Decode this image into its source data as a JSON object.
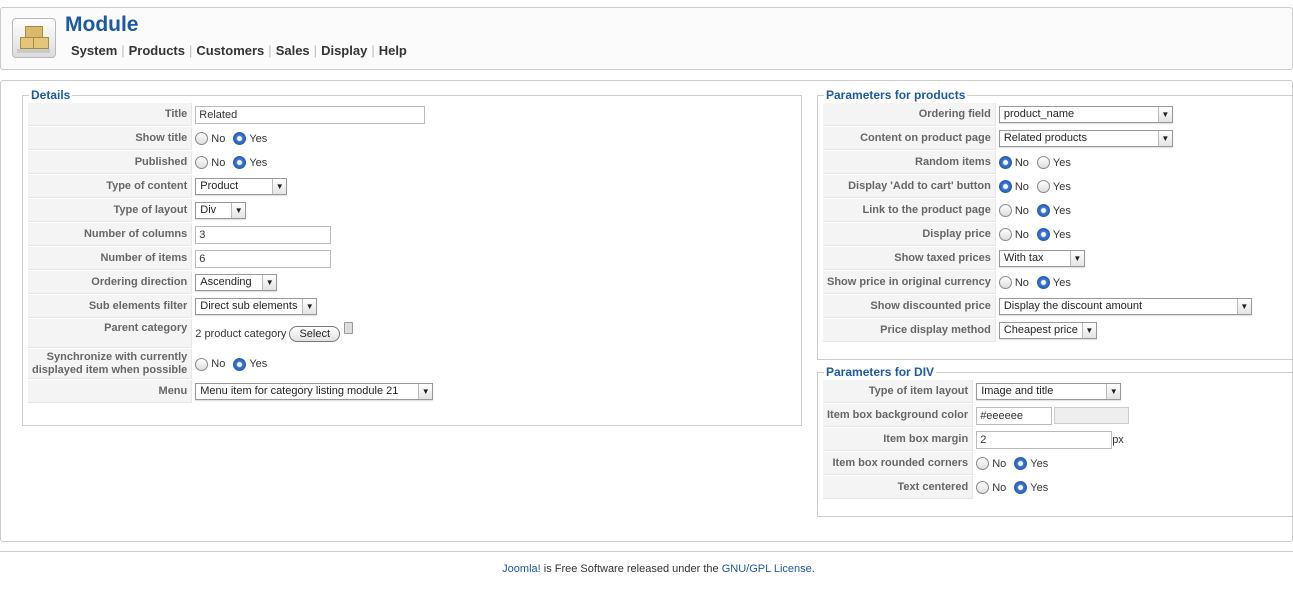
{
  "header": {
    "title": "Module",
    "menu": [
      "System",
      "Products",
      "Customers",
      "Sales",
      "Display",
      "Help"
    ]
  },
  "details": {
    "legend": "Details",
    "title_label": "Title",
    "title_value": "Related",
    "show_title_label": "Show title",
    "published_label": "Published",
    "type_of_content_label": "Type of content",
    "type_of_content_value": "Product",
    "type_of_layout_label": "Type of layout",
    "type_of_layout_value": "Div",
    "number_of_columns_label": "Number of columns",
    "number_of_columns_value": "3",
    "number_of_items_label": "Number of items",
    "number_of_items_value": "6",
    "ordering_direction_label": "Ordering direction",
    "ordering_direction_value": "Ascending",
    "sub_elements_filter_label": "Sub elements filter",
    "sub_elements_filter_value": "Direct sub elements",
    "parent_category_label": "Parent category",
    "parent_category_value": "2 product category",
    "select_button": "Select",
    "sync_label_1": "Synchronize with currently",
    "sync_label_2": "displayed item when possible",
    "menu_label": "Menu",
    "menu_value": "Menu item for category listing module 21"
  },
  "products": {
    "legend": "Parameters for products",
    "ordering_field_label": "Ordering field",
    "ordering_field_value": "product_name",
    "content_label": "Content on product page",
    "content_value": "Related products",
    "random_items_label": "Random items",
    "add_to_cart_label": "Display 'Add to cart' button",
    "link_label": "Link to the product page",
    "display_price_label": "Display price",
    "taxed_label": "Show taxed prices",
    "taxed_value": "With tax",
    "original_currency_label": "Show price in original currency",
    "discounted_label": "Show discounted price",
    "discounted_value": "Display the discount amount",
    "price_method_label": "Price display method",
    "price_method_value": "Cheapest price"
  },
  "div": {
    "legend": "Parameters for DIV",
    "item_layout_label": "Type of item layout",
    "item_layout_value": "Image and title",
    "bg_color_label": "Item box background color",
    "bg_color_value": "#eeeeee",
    "margin_label": "Item box margin",
    "margin_value": "2",
    "margin_unit": "px",
    "rounded_label": "Item box rounded corners",
    "centered_label": "Text centered"
  },
  "radio": {
    "no": "No",
    "yes": "Yes"
  },
  "footer": {
    "joomla": "Joomla!",
    "text": " is Free Software released under the ",
    "license": "GNU/GPL License",
    "end": "."
  },
  "colors": {
    "accent": "#1c59a5",
    "label_bg": "#f4f4f4"
  }
}
